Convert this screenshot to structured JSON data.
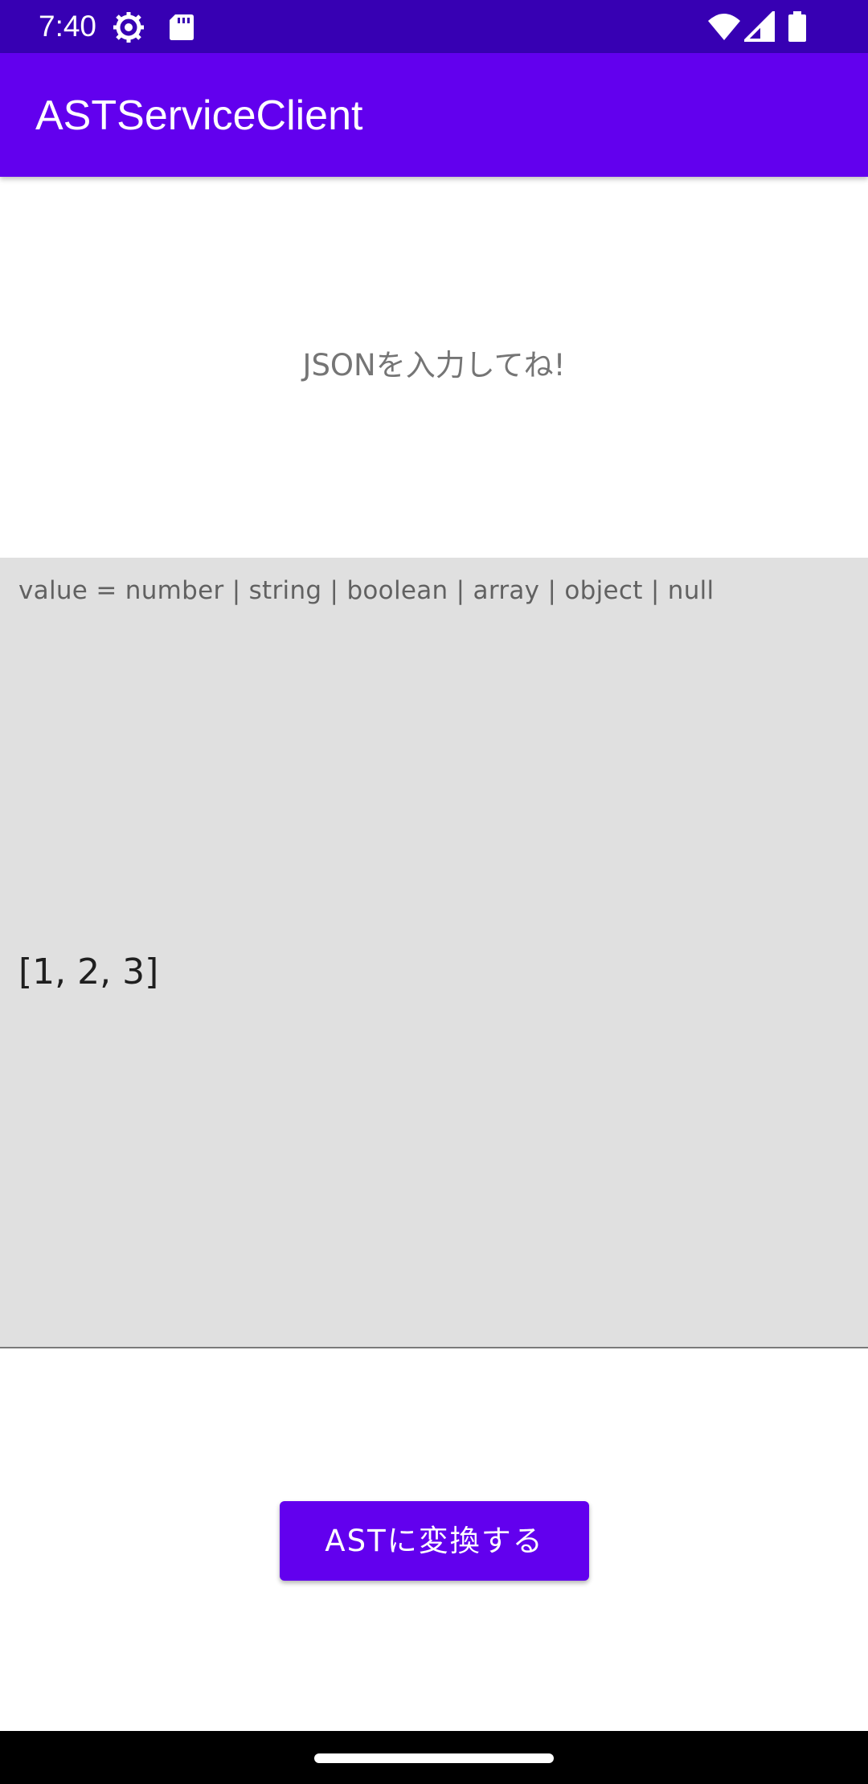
{
  "status_bar": {
    "time": "7:40",
    "icons": [
      "settings-icon",
      "sd-card-icon",
      "wifi-icon",
      "signal-icon",
      "battery-icon"
    ]
  },
  "app_bar": {
    "title": "ASTServiceClient"
  },
  "main": {
    "prompt": "JSONを入力してね!",
    "input": {
      "hint": "value = number | string | boolean | array | object | null",
      "value": "[1, 2, 3]"
    },
    "convert_button_label": "ASTに変換する"
  },
  "colors": {
    "status_bar": "#3700b3",
    "primary": "#6200ee",
    "input_background": "#e0e0e0"
  }
}
